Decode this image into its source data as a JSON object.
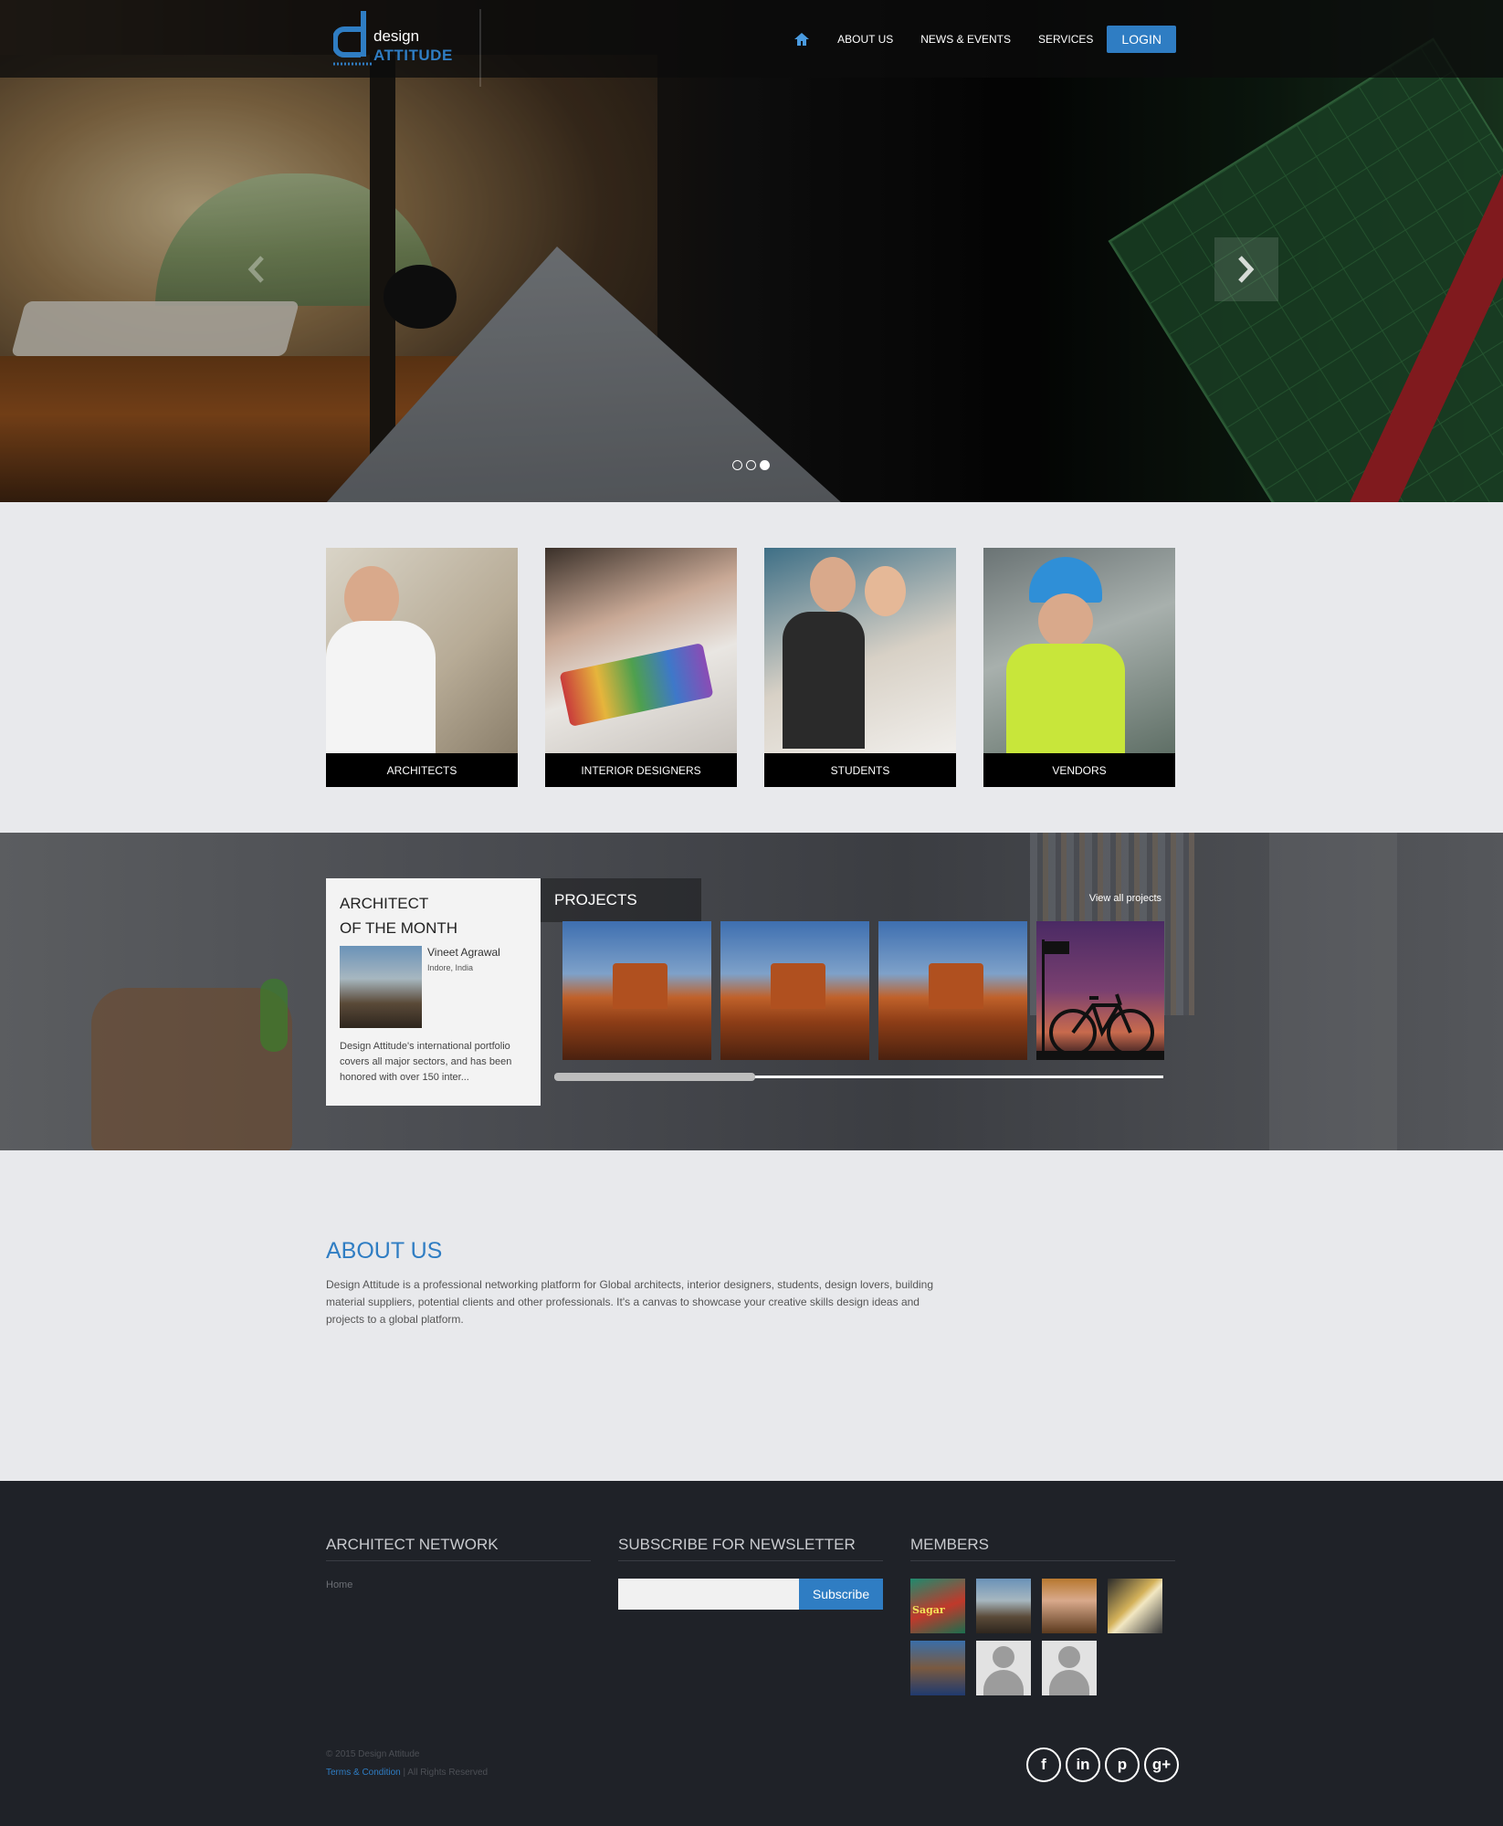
{
  "brand": {
    "logo_word_top": "design",
    "logo_word_bottom": "ATTITUDE",
    "accent_color": "#2f7dc3"
  },
  "nav": {
    "home_icon": "home-icon",
    "items": [
      "ABOUT US",
      "NEWS & EVENTS",
      "SERVICES"
    ],
    "login_label": "LOGIN"
  },
  "hero": {
    "slide_count": 3,
    "active_slide": 3
  },
  "categories": [
    {
      "label": "ARCHITECTS"
    },
    {
      "label": "INTERIOR DESIGNERS"
    },
    {
      "label": "STUDENTS"
    },
    {
      "label": "VENDORS"
    }
  ],
  "architect_of_month": {
    "heading_line1": "ARCHITECT",
    "heading_line2": "OF THE MONTH",
    "name": "Vineet Agrawal",
    "location": "Indore, India",
    "description": "Design Attitude's international portfolio covers all major sectors, and has been honored with over 150 inter..."
  },
  "projects": {
    "heading": "PROJECTS",
    "view_all": "View all projects",
    "scroll_position": 0.33
  },
  "about": {
    "heading": "ABOUT US",
    "body": "Design Attitude is a professional networking platform for Global architects, interior designers, students, design lovers, building material suppliers, potential clients and other professionals. It's a canvas to showcase your creative skills design ideas and projects to a global platform."
  },
  "footer": {
    "network": {
      "heading": "ARCHITECT NETWORK",
      "link": "Home"
    },
    "newsletter": {
      "heading": "SUBSCRIBE FOR NEWSLETTER",
      "input_value": "",
      "button": "Subscribe"
    },
    "members": {
      "heading": "MEMBERS",
      "avatar_text": "Sagar"
    },
    "copyright": "© 2015 Design Attitude",
    "terms_link": "Terms & Condition",
    "rights": "| All Rights Reserved",
    "social": {
      "facebook": "f",
      "linkedin": "in",
      "pinterest": "p",
      "googleplus": "g+"
    }
  }
}
